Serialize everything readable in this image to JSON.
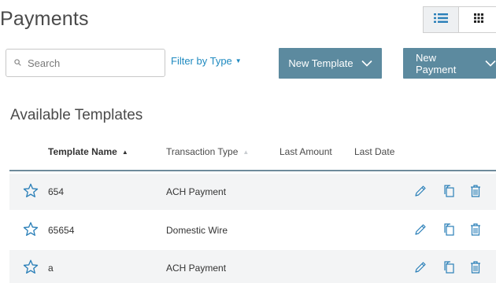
{
  "page": {
    "title": "Payments"
  },
  "view_toggle": {
    "list_icon": "list-icon",
    "grid_icon": "grid-icon",
    "active": "list"
  },
  "search": {
    "placeholder": "Search",
    "icon": "search-icon"
  },
  "filter": {
    "label": "Filter by Type",
    "icon": "caret-down-icon"
  },
  "buttons": {
    "new_template": "New Template",
    "new_payment": "New Payment",
    "icon": "chevron-down-icon"
  },
  "section": {
    "title": "Available Templates"
  },
  "table": {
    "columns": [
      {
        "label": "Template Name",
        "sorted": "asc"
      },
      {
        "label": "Transaction Type",
        "sorted": "none"
      },
      {
        "label": "Last Amount"
      },
      {
        "label": "Last Date"
      }
    ],
    "rows": [
      {
        "name": "654",
        "type": "ACH Payment",
        "last_amount": "",
        "last_date": ""
      },
      {
        "name": "65654",
        "type": "Domestic Wire",
        "last_amount": "",
        "last_date": ""
      },
      {
        "name": "a",
        "type": "ACH Payment",
        "last_amount": "",
        "last_date": ""
      }
    ],
    "row_icons": [
      "star-icon",
      "edit-pencil-icon",
      "copy-icon",
      "delete-trash-icon"
    ]
  },
  "colors": {
    "accent": "#1f8ac0",
    "button": "#5c8a9f",
    "icon": "#2a7fb8",
    "header_rule": "#6e8b9b",
    "alt_row": "#f3f4f5"
  }
}
